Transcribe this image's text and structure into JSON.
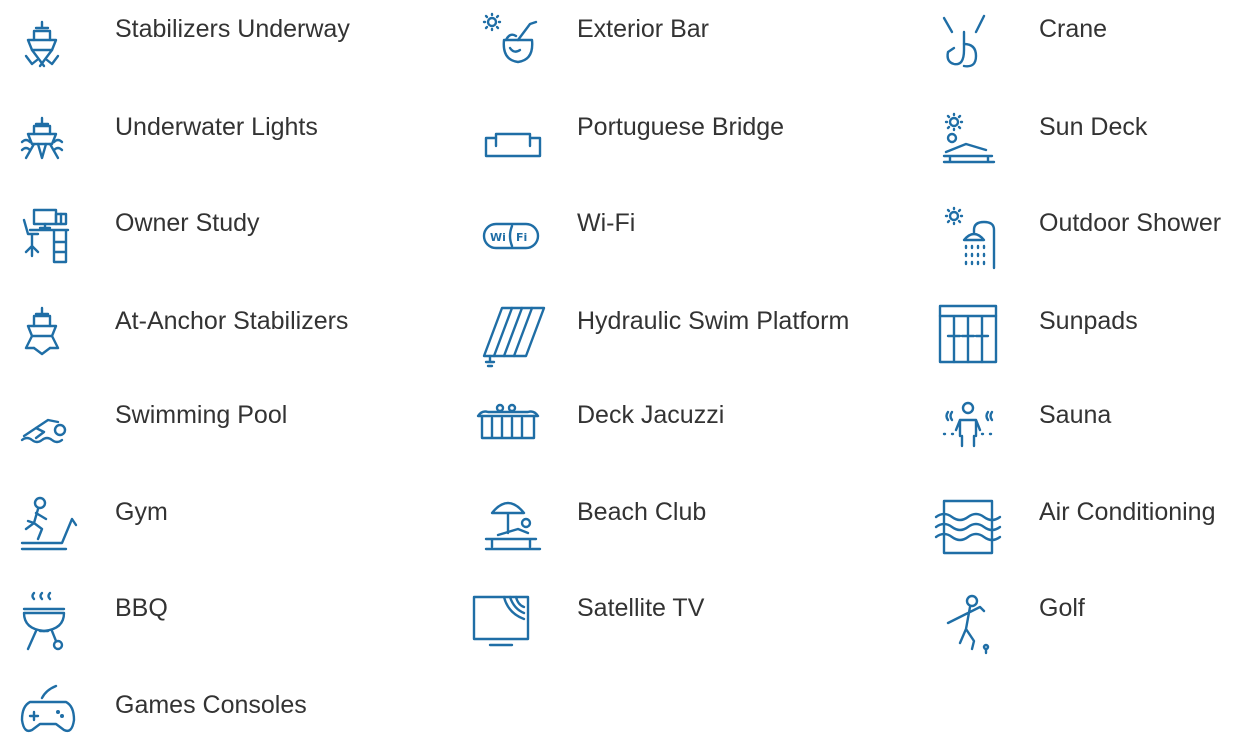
{
  "accent_color": "#1f6ea6",
  "text_color": "#333333",
  "amenities": [
    {
      "label": "Stabilizers Underway",
      "icon": "ship-stabilizers-icon"
    },
    {
      "label": "Underwater Lights",
      "icon": "underwater-lights-icon"
    },
    {
      "label": "Owner Study",
      "icon": "owner-study-icon"
    },
    {
      "label": "At-Anchor Stabilizers",
      "icon": "at-anchor-stabilizers-icon"
    },
    {
      "label": "Swimming Pool",
      "icon": "swimmer-icon"
    },
    {
      "label": "Gym",
      "icon": "treadmill-runner-icon"
    },
    {
      "label": "BBQ",
      "icon": "grill-icon"
    },
    {
      "label": "Games Consoles",
      "icon": "game-controller-icon"
    },
    {
      "label": "Exterior Bar",
      "icon": "coconut-drink-icon"
    },
    {
      "label": "Portuguese Bridge",
      "icon": "sofa-bridge-icon"
    },
    {
      "label": "Wi-Fi",
      "icon": "wifi-icon",
      "icon_text_left": "Wi",
      "icon_text_right": "Fi"
    },
    {
      "label": "Hydraulic Swim Platform",
      "icon": "swim-platform-icon"
    },
    {
      "label": "Deck Jacuzzi",
      "icon": "jacuzzi-icon"
    },
    {
      "label": "Beach Club",
      "icon": "beach-umbrella-lounger-icon"
    },
    {
      "label": "Satellite TV",
      "icon": "satellite-tv-icon"
    },
    {
      "label": "Crane",
      "icon": "crane-hook-icon"
    },
    {
      "label": "Sun Deck",
      "icon": "sun-lounger-icon"
    },
    {
      "label": "Outdoor Shower",
      "icon": "outdoor-shower-icon"
    },
    {
      "label": "Sunpads",
      "icon": "sunpads-icon"
    },
    {
      "label": "Sauna",
      "icon": "sauna-icon"
    },
    {
      "label": "Air Conditioning",
      "icon": "air-conditioning-icon"
    },
    {
      "label": "Golf",
      "icon": "golfer-icon"
    }
  ]
}
